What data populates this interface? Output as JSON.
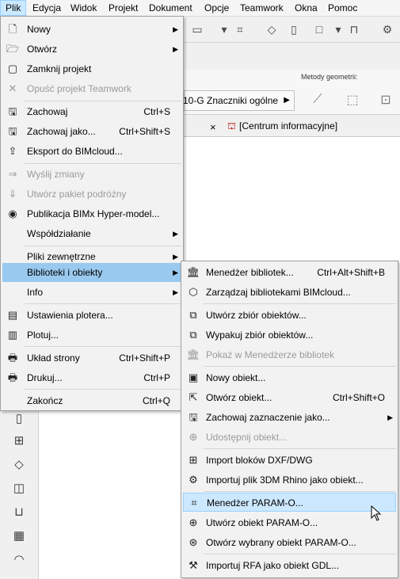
{
  "menubar": {
    "items": [
      "Plik",
      "Edycja",
      "Widok",
      "Projekt",
      "Dokument",
      "Opcje",
      "Teamwork",
      "Okna",
      "Pomoc"
    ]
  },
  "background": {
    "layer_value": "10-G Znaczniki ogólne",
    "methods_label": "Metody geometrii:",
    "tab_label": "[Centrum informacyjne]",
    "tab_close": "×"
  },
  "file_menu": {
    "items": [
      {
        "label": "Nowy",
        "icon": "new-document-icon",
        "submenu": true
      },
      {
        "label": "Otwórz",
        "icon": "open-folder-icon",
        "submenu": true
      },
      {
        "label": "Zamknij projekt",
        "icon": "close-project-icon"
      },
      {
        "label": "Opuść projekt Teamwork",
        "icon": "leave-teamwork-icon",
        "disabled": true
      },
      {
        "label": "Zachowaj",
        "icon": "save-icon",
        "shortcut": "Ctrl+S"
      },
      {
        "label": "Zachowaj jako...",
        "icon": "save-as-icon",
        "shortcut": "Ctrl+Shift+S"
      },
      {
        "label": "Eksport do BIMcloud...",
        "icon": "bimcloud-export-icon"
      },
      {
        "label": "Wyślij zmiany",
        "icon": "send-changes-icon",
        "disabled": true
      },
      {
        "label": "Utwórz pakiet podróżny",
        "icon": "travel-package-icon",
        "disabled": true
      },
      {
        "label": "Publikacja BIMx Hyper-model...",
        "icon": "bimx-icon"
      },
      {
        "label": "Współdziałanie",
        "submenu": true
      },
      {
        "label": "Pliki zewnętrzne",
        "submenu": true
      },
      {
        "label": "Biblioteki i obiekty",
        "submenu": true,
        "highlighted": true
      },
      {
        "label": "Info",
        "submenu": true
      },
      {
        "label": "Ustawienia plotera...",
        "icon": "plotter-settings-icon"
      },
      {
        "label": "Plotuj...",
        "icon": "plot-icon"
      },
      {
        "label": "Układ strony",
        "icon": "page-setup-icon",
        "shortcut": "Ctrl+Shift+P"
      },
      {
        "label": "Drukuj...",
        "icon": "print-icon",
        "shortcut": "Ctrl+P"
      },
      {
        "label": "Zakończ",
        "shortcut": "Ctrl+Q"
      }
    ]
  },
  "library_submenu": {
    "items": [
      {
        "label": "Menedżer bibliotek...",
        "icon": "library-manager-icon",
        "shortcut": "Ctrl+Alt+Shift+B"
      },
      {
        "label": "Zarządzaj bibliotekami BIMcloud...",
        "icon": "bimcloud-libraries-icon"
      },
      {
        "label": "Utwórz zbiór obiektów...",
        "icon": "create-object-set-icon"
      },
      {
        "label": "Wypakuj zbiór obiektów...",
        "icon": "extract-object-set-icon"
      },
      {
        "label": "Pokaż w Menedżerze bibliotek",
        "icon": "show-in-library-icon",
        "disabled": true
      },
      {
        "label": "Nowy obiekt...",
        "icon": "new-object-icon"
      },
      {
        "label": "Otwórz obiekt...",
        "icon": "open-object-icon",
        "shortcut": "Ctrl+Shift+O"
      },
      {
        "label": "Zachowaj zaznaczenie jako...",
        "icon": "save-selection-icon",
        "submenu": true
      },
      {
        "label": "Udostępnij obiekt...",
        "icon": "share-object-icon",
        "disabled": true
      },
      {
        "label": "Import bloków DXF/DWG",
        "icon": "import-dxf-icon"
      },
      {
        "label": "Importuj plik 3DM Rhino jako obiekt...",
        "icon": "import-rhino-icon"
      },
      {
        "label": "Menedżer PARAM-O...",
        "icon": "param-o-manager-icon",
        "highlighted": true
      },
      {
        "label": "Utwórz obiekt PARAM-O...",
        "icon": "create-param-o-icon"
      },
      {
        "label": "Otwórz wybrany obiekt PARAM-O...",
        "icon": "open-param-o-icon"
      },
      {
        "label": "Importuj RFA jako obiekt GDL...",
        "icon": "import-rfa-icon"
      }
    ]
  },
  "colors": {
    "highlight": "#99c9ef",
    "hover": "#cce8ff",
    "disabled_text": "#9a9a9a"
  }
}
